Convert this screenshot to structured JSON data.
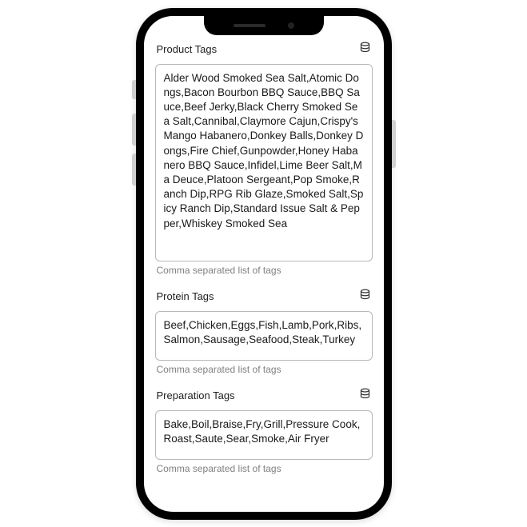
{
  "sections": {
    "product": {
      "label": "Product Tags",
      "value": "Alder Wood Smoked Sea Salt,Atomic Dongs,Bacon Bourbon BBQ Sauce,BBQ Sauce,Beef Jerky,Black Cherry Smoked Sea Salt,Cannibal,Claymore Cajun,Crispy's Mango Habanero,Donkey Balls,Donkey Dongs,Fire Chief,Gunpowder,Honey Habanero BBQ Sauce,Infidel,Lime Beer Salt,Ma Deuce,Platoon Sergeant,Pop Smoke,Ranch Dip,RPG Rib Glaze,Smoked Salt,Spicy Ranch Dip,Standard Issue Salt & Pepper,Whiskey Smoked Sea",
      "hint": "Comma separated list of tags"
    },
    "protein": {
      "label": "Protein Tags",
      "value": "Beef,Chicken,Eggs,Fish,Lamb,Pork,Ribs,Salmon,Sausage,Seafood,Steak,Turkey",
      "hint": "Comma separated list of tags"
    },
    "preparation": {
      "label": "Preparation Tags",
      "value": "Bake,Boil,Braise,Fry,Grill,Pressure Cook,Roast,Saute,Sear,Smoke,Air Fryer",
      "hint": "Comma separated list of tags"
    }
  }
}
